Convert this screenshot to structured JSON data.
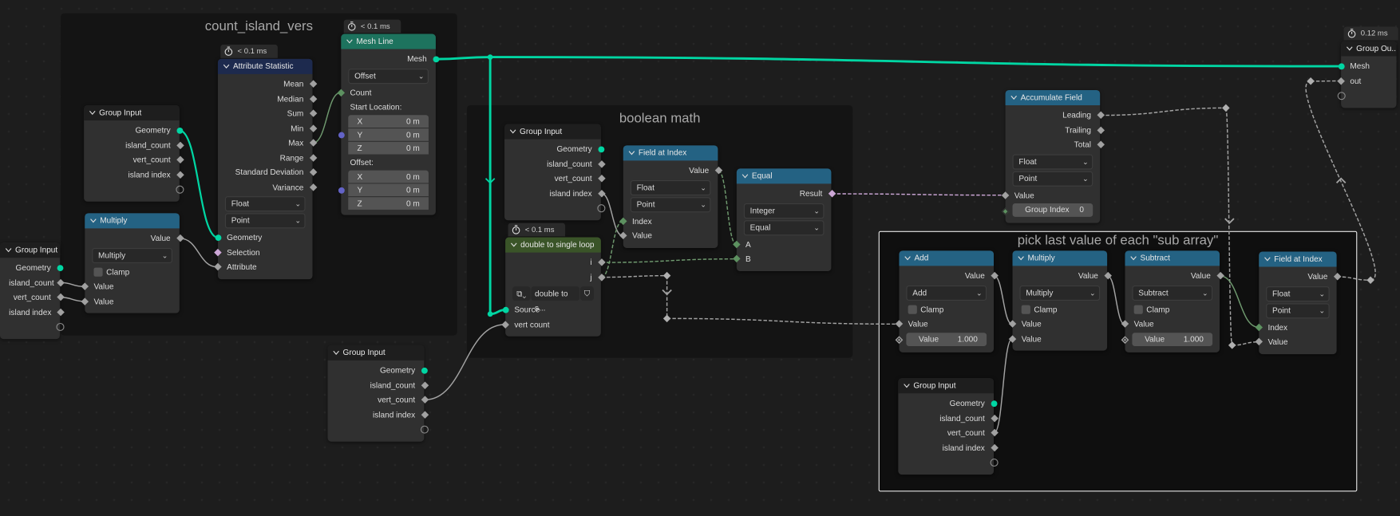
{
  "colors": {
    "geometry": "#00d6a3",
    "float": "#a1a1a1",
    "integer": "#5d9160",
    "boolean": "#cca6d6",
    "vector": "#6363c7",
    "header_group": "#1e1e1e",
    "header_math": "#246283",
    "header_attribute": "#1d2a4e",
    "header_mesh": "#1d735e",
    "header_nodegroup": "#3a5428"
  },
  "frames": [
    {
      "id": "f1",
      "title": "count_island_vers"
    },
    {
      "id": "f2",
      "title": "boolean math"
    },
    {
      "id": "f3",
      "title": "pick last value of each \"sub array\""
    }
  ],
  "nodes": [
    {
      "id": "gi_left",
      "title": "Group Input",
      "kind": "group",
      "rows": [
        {
          "t": "out",
          "label": "Geometry",
          "s": "geo"
        },
        {
          "t": "out",
          "label": "island_count",
          "s": "float"
        },
        {
          "t": "out",
          "label": "vert_count",
          "s": "float"
        },
        {
          "t": "out",
          "label": "island index",
          "s": "float"
        },
        {
          "t": "out",
          "label": "",
          "s": "empty"
        }
      ]
    },
    {
      "id": "gi_a",
      "title": "Group Input",
      "kind": "group",
      "rows": [
        {
          "t": "out",
          "label": "Geometry",
          "s": "geo"
        },
        {
          "t": "out",
          "label": "island_count",
          "s": "float"
        },
        {
          "t": "out",
          "label": "vert_count",
          "s": "float"
        },
        {
          "t": "out",
          "label": "island index",
          "s": "float"
        },
        {
          "t": "out",
          "label": "",
          "s": "empty"
        }
      ]
    },
    {
      "id": "mul_a",
      "title": "Multiply",
      "kind": "math",
      "rows": [
        {
          "t": "out",
          "label": "Value",
          "s": "float"
        },
        {
          "t": "dd",
          "value": "Multiply"
        },
        {
          "t": "cb",
          "label": "Clamp"
        },
        {
          "t": "in",
          "label": "Value",
          "s": "float"
        },
        {
          "t": "in",
          "label": "Value",
          "s": "float"
        }
      ]
    },
    {
      "id": "attr_stat",
      "title": "Attribute Statistic",
      "kind": "attribute",
      "timer": "< 0.1 ms",
      "rows": [
        {
          "t": "out",
          "label": "Mean",
          "s": "float"
        },
        {
          "t": "out",
          "label": "Median",
          "s": "float"
        },
        {
          "t": "out",
          "label": "Sum",
          "s": "float"
        },
        {
          "t": "out",
          "label": "Min",
          "s": "float"
        },
        {
          "t": "out",
          "label": "Max",
          "s": "float"
        },
        {
          "t": "out",
          "label": "Range",
          "s": "float"
        },
        {
          "t": "out",
          "label": "Standard Deviation",
          "s": "float"
        },
        {
          "t": "out",
          "label": "Variance",
          "s": "float"
        },
        {
          "t": "dd",
          "value": "Float"
        },
        {
          "t": "dd",
          "value": "Point"
        },
        {
          "t": "in",
          "label": "Geometry",
          "s": "geo"
        },
        {
          "t": "in",
          "label": "Selection",
          "s": "bool"
        },
        {
          "t": "in",
          "label": "Attribute",
          "s": "float"
        }
      ]
    },
    {
      "id": "mesh_line",
      "title": "Mesh Line",
      "kind": "mesh",
      "timer": "< 0.1 ms",
      "rows": [
        {
          "t": "out",
          "label": "Mesh",
          "s": "geo"
        },
        {
          "t": "dd",
          "value": "Offset"
        },
        {
          "t": "in",
          "label": "Count",
          "s": "int"
        },
        {
          "t": "lbl",
          "label": "Start Location:"
        },
        {
          "t": "vec",
          "s": "vec",
          "items": [
            {
              "axis": "X",
              "value": "0 m"
            },
            {
              "axis": "Y",
              "value": "0 m"
            },
            {
              "axis": "Z",
              "value": "0 m"
            }
          ]
        },
        {
          "t": "lbl",
          "label": "Offset:"
        },
        {
          "t": "vec",
          "s": "vec",
          "items": [
            {
              "axis": "X",
              "value": "0 m"
            },
            {
              "axis": "Y",
              "value": "0 m"
            },
            {
              "axis": "Z",
              "value": "0 m"
            }
          ]
        }
      ]
    },
    {
      "id": "gi_b",
      "title": "Group Input",
      "kind": "group",
      "rows": [
        {
          "t": "out",
          "label": "Geometry",
          "s": "geo"
        },
        {
          "t": "out",
          "label": "island_count",
          "s": "float"
        },
        {
          "t": "out",
          "label": "vert_count",
          "s": "float"
        },
        {
          "t": "out",
          "label": "island index",
          "s": "float"
        },
        {
          "t": "out",
          "label": "",
          "s": "empty"
        }
      ]
    },
    {
      "id": "fai_1",
      "title": "Field at Index",
      "kind": "math",
      "rows": [
        {
          "t": "out",
          "label": "Value",
          "s": "float"
        },
        {
          "t": "dd",
          "value": "Float"
        },
        {
          "t": "dd",
          "value": "Point"
        },
        {
          "t": "in",
          "label": "Index",
          "s": "int"
        },
        {
          "t": "in",
          "label": "Value",
          "s": "float"
        }
      ]
    },
    {
      "id": "equal",
      "title": "Equal",
      "kind": "math",
      "rows": [
        {
          "t": "out",
          "label": "Result",
          "s": "bool"
        },
        {
          "t": "dd",
          "value": "Integer"
        },
        {
          "t": "dd",
          "value": "Equal"
        },
        {
          "t": "in",
          "label": "A",
          "s": "int"
        },
        {
          "t": "in",
          "label": "B",
          "s": "int"
        }
      ]
    },
    {
      "id": "loop",
      "title": "double to single loop",
      "kind": "nodegroup",
      "timer": "< 0.1 ms",
      "rows": [
        {
          "t": "out",
          "label": "i",
          "s": "float"
        },
        {
          "t": "out",
          "label": "j",
          "s": "float"
        },
        {
          "t": "grp",
          "value": "double to s..."
        },
        {
          "t": "in",
          "label": "Source",
          "s": "geo"
        },
        {
          "t": "in",
          "label": "vert count",
          "s": "float"
        }
      ]
    },
    {
      "id": "gi_c",
      "title": "Group Input",
      "kind": "group",
      "rows": [
        {
          "t": "out",
          "label": "Geometry",
          "s": "geo"
        },
        {
          "t": "out",
          "label": "island_count",
          "s": "float"
        },
        {
          "t": "out",
          "label": "vert_count",
          "s": "float"
        },
        {
          "t": "out",
          "label": "island index",
          "s": "float"
        },
        {
          "t": "out",
          "label": "",
          "s": "empty"
        }
      ]
    },
    {
      "id": "accum",
      "title": "Accumulate Field",
      "kind": "math",
      "rows": [
        {
          "t": "out",
          "label": "Leading",
          "s": "float"
        },
        {
          "t": "out",
          "label": "Trailing",
          "s": "float"
        },
        {
          "t": "out",
          "label": "Total",
          "s": "float"
        },
        {
          "t": "dd",
          "value": "Float"
        },
        {
          "t": "dd",
          "value": "Point"
        },
        {
          "t": "in",
          "label": "Value",
          "s": "float"
        },
        {
          "t": "fld",
          "label": "Group Index",
          "value": "0",
          "s": "idot"
        }
      ]
    },
    {
      "id": "gout",
      "title": "Group Ou...",
      "kind": "group",
      "timer": "0.12 ms",
      "rows": [
        {
          "t": "in",
          "label": "Mesh",
          "s": "geo"
        },
        {
          "t": "in",
          "label": "out",
          "s": "float"
        },
        {
          "t": "in",
          "label": "",
          "s": "empty"
        }
      ]
    },
    {
      "id": "add",
      "title": "Add",
      "kind": "math",
      "rows": [
        {
          "t": "out",
          "label": "Value",
          "s": "float"
        },
        {
          "t": "dd",
          "value": "Add"
        },
        {
          "t": "cb",
          "label": "Clamp"
        },
        {
          "t": "in",
          "label": "Value",
          "s": "float"
        },
        {
          "t": "fld",
          "label": "Value",
          "value": "1.000",
          "s": "fdot"
        }
      ]
    },
    {
      "id": "mul_b",
      "title": "Multiply",
      "kind": "math",
      "rows": [
        {
          "t": "out",
          "label": "Value",
          "s": "float"
        },
        {
          "t": "dd",
          "value": "Multiply"
        },
        {
          "t": "cb",
          "label": "Clamp"
        },
        {
          "t": "in",
          "label": "Value",
          "s": "float"
        },
        {
          "t": "in",
          "label": "Value",
          "s": "float"
        }
      ]
    },
    {
      "id": "sub",
      "title": "Subtract",
      "kind": "math",
      "rows": [
        {
          "t": "out",
          "label": "Value",
          "s": "float"
        },
        {
          "t": "dd",
          "value": "Subtract"
        },
        {
          "t": "cb",
          "label": "Clamp"
        },
        {
          "t": "in",
          "label": "Value",
          "s": "float"
        },
        {
          "t": "fld",
          "label": "Value",
          "value": "1.000",
          "s": "fdot"
        }
      ]
    },
    {
      "id": "fai_2",
      "title": "Field at Index",
      "kind": "math",
      "rows": [
        {
          "t": "out",
          "label": "Value",
          "s": "float"
        },
        {
          "t": "dd",
          "value": "Float"
        },
        {
          "t": "dd",
          "value": "Point"
        },
        {
          "t": "in",
          "label": "Index",
          "s": "int"
        },
        {
          "t": "in",
          "label": "Value",
          "s": "float"
        }
      ]
    },
    {
      "id": "gi_d",
      "title": "Group Input",
      "kind": "group",
      "rows": [
        {
          "t": "out",
          "label": "Geometry",
          "s": "geo"
        },
        {
          "t": "out",
          "label": "island_count",
          "s": "float"
        },
        {
          "t": "out",
          "label": "vert_count",
          "s": "float"
        },
        {
          "t": "out",
          "label": "island index",
          "s": "float"
        },
        {
          "t": "out",
          "label": "",
          "s": "empty"
        }
      ]
    }
  ]
}
